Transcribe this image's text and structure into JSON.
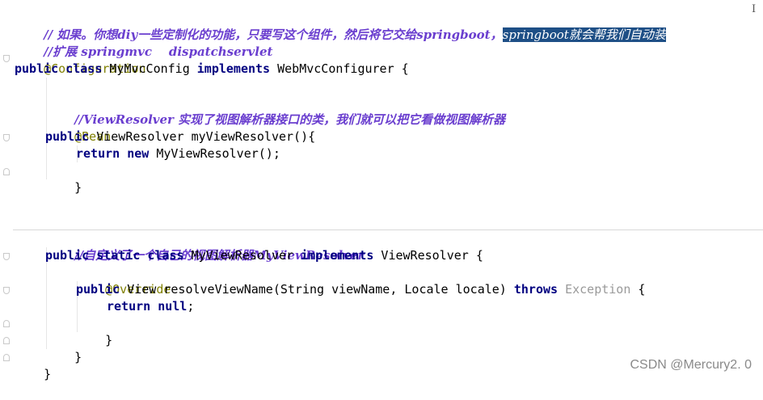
{
  "code": {
    "line1": {
      "a": "// 如果。你想diy一些定制化的功能，只要写这个组件，然后将它交给springboot，",
      "b": "springboot就会帮我们自动装"
    },
    "line2": "//扩展 springmvc    dispatchservlet",
    "line3": "@Configuration",
    "line4": {
      "kw": "public class",
      "rest": " MyMvcConfig ",
      "kw2": "implements",
      "rest2": " WebMvcConfigurer {"
    },
    "line6": "//ViewResolver 实现了视图解析器接口的类，我们就可以把它看做视图解析器",
    "line7": "@Bean",
    "line8": {
      "kw": "public",
      "rest": " ViewResolver myViewResolver(){"
    },
    "line9": {
      "kw": "return new",
      "rest": " MyViewResolver();"
    },
    "line10": "}",
    "line14": "//自定义了一个自己的视图解析器MyViewResolver",
    "line15": {
      "kw": "public static class",
      "rest": " MyViewResolver ",
      "kw2": "implements",
      "rest2": " ViewResolver {"
    },
    "line16": "@Override",
    "line17": {
      "kw": "public",
      "rest": " View resolveViewName(String viewName, Locale locale) ",
      "kw2": "throws",
      "gray": " Exception",
      "rest2": " {"
    },
    "line18": {
      "kw": "return null",
      "rest": ";"
    },
    "line19": "}",
    "line20": "}",
    "line21": "}"
  },
  "watermark": "CSDN @Mercury2. 0",
  "colors": {
    "keyword": "#000080",
    "annotation": "#808000",
    "comment": "#6a3ecf",
    "selection": "#1e4f86"
  }
}
